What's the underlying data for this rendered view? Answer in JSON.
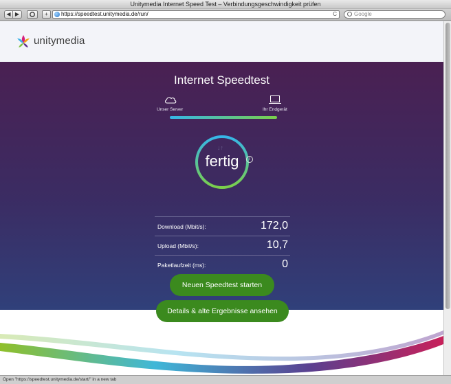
{
  "window": {
    "title": "Unitymedia Internet Speed Test – Verbindungsgeschwindigkeit prüfen"
  },
  "toolbar": {
    "back_label": "◀",
    "forward_label": "▶",
    "add_label": "+",
    "url": "https://speedtest.unitymedia.de/run/",
    "reload_label": "C",
    "search_placeholder": "Google"
  },
  "brand": {
    "name": "unitymedia",
    "colors": {
      "hero_top": "#4a2052",
      "hero_bottom": "#30407a",
      "button": "#3b8a1e",
      "progress_start": "#36b6e8",
      "progress_end": "#7bcf4a"
    }
  },
  "speedtest": {
    "title": "Internet Speedtest",
    "server_label": "Unser Server",
    "device_label": "Ihr Endgerät",
    "status": "fertig",
    "info_label": "i",
    "results": [
      {
        "label": "Download (Mbit/s):",
        "value": "172,0"
      },
      {
        "label": "Upload (Mbit/s):",
        "value": "10,7"
      },
      {
        "label": "Paketlaufzeit (ms):",
        "value": "0"
      }
    ],
    "new_test_button": "Neuen Speedtest starten",
    "details_button": "Details & alte Ergebnisse ansehen"
  },
  "statusbar": {
    "text": "Open \"https://speedtest.unitymedia.de/start/\" in a new tab"
  }
}
